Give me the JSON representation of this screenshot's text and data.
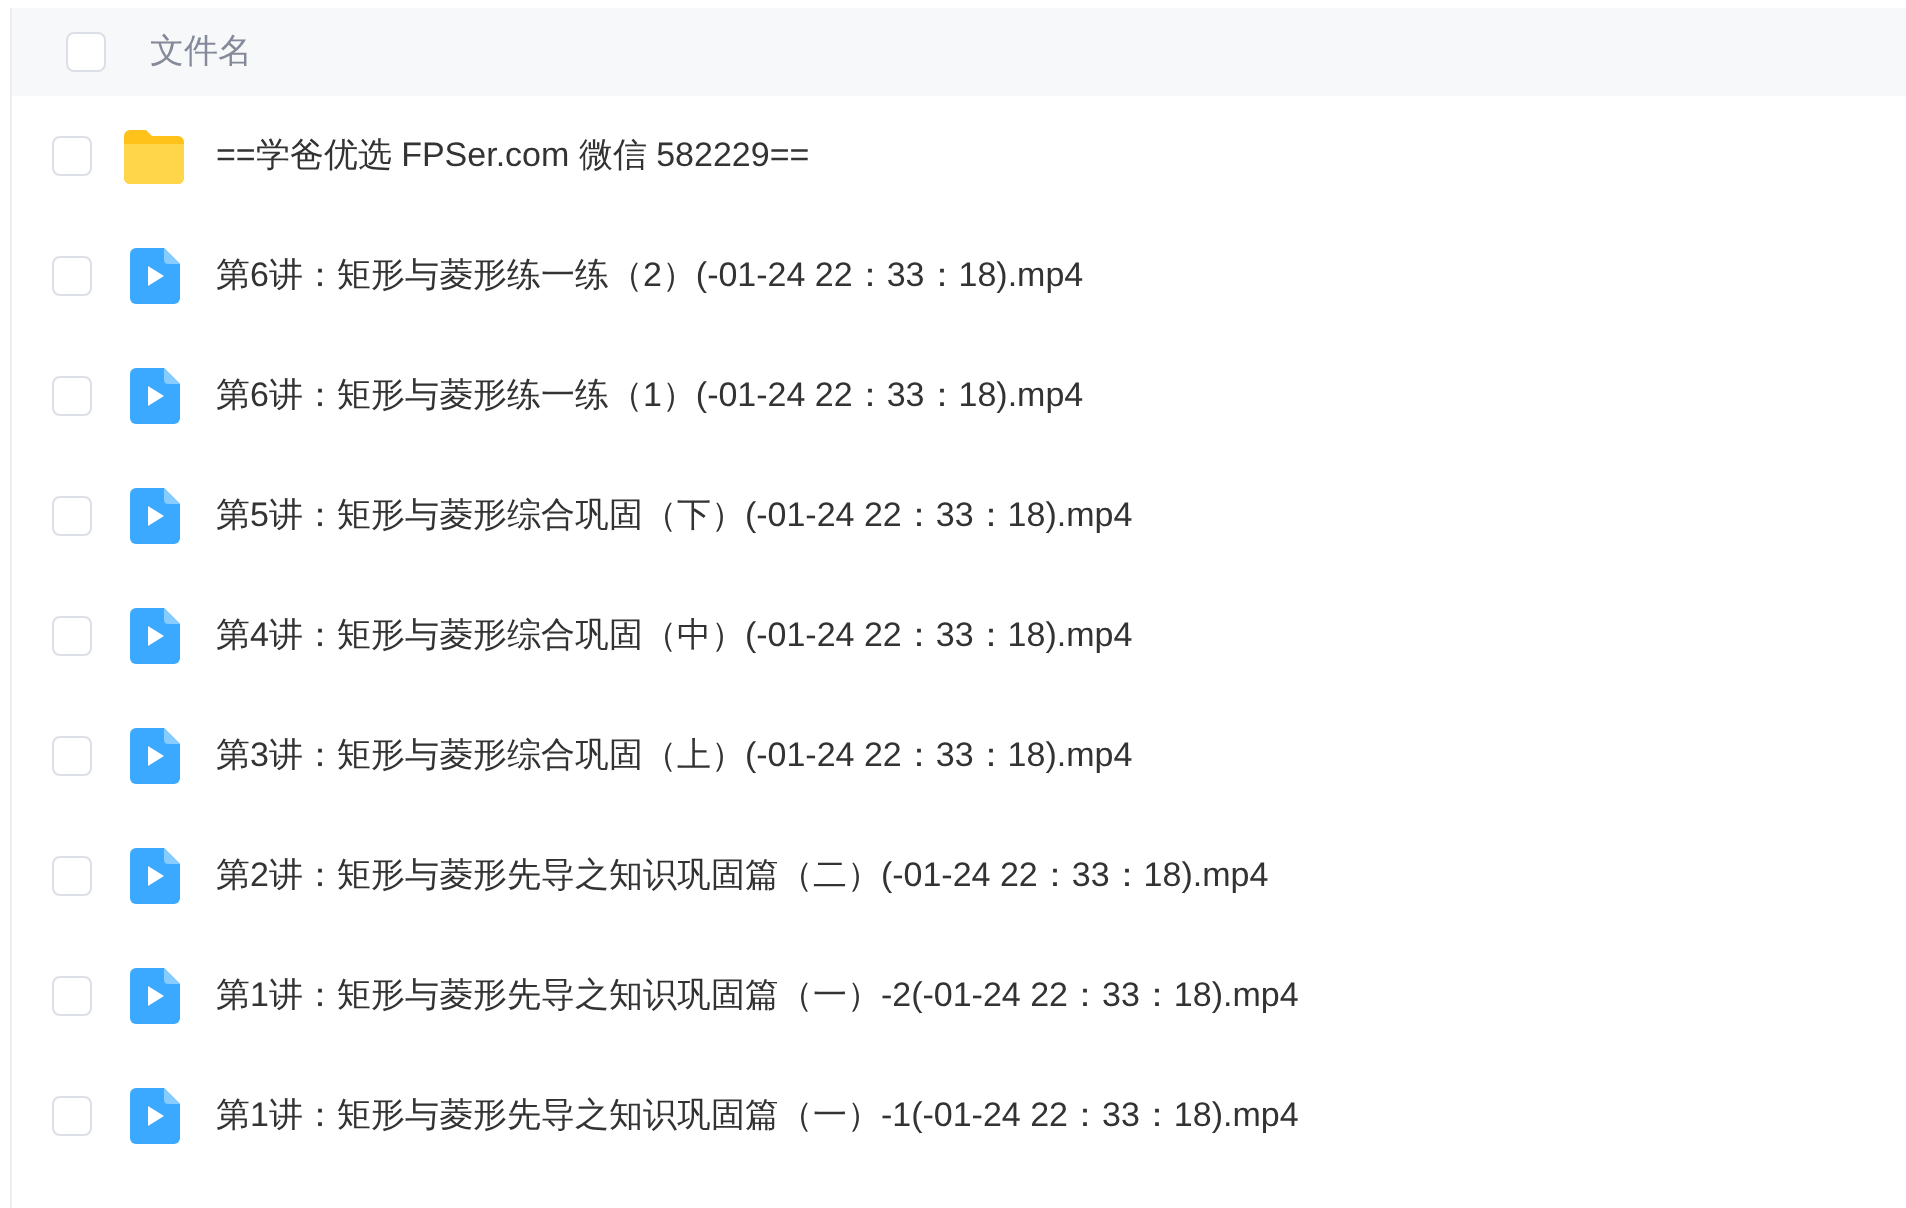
{
  "header": {
    "column_label": "文件名",
    "checked": false
  },
  "files": [
    {
      "kind": "folder",
      "name": "==学爸优选 FPSer.com 微信 582229==",
      "checked": false
    },
    {
      "kind": "video",
      "name": "第6讲：矩形与菱形练一练（2）(-01-24 22：33：18).mp4",
      "checked": false
    },
    {
      "kind": "video",
      "name": "第6讲：矩形与菱形练一练（1）(-01-24 22：33：18).mp4",
      "checked": false
    },
    {
      "kind": "video",
      "name": "第5讲：矩形与菱形综合巩固（下）(-01-24 22：33：18).mp4",
      "checked": false
    },
    {
      "kind": "video",
      "name": "第4讲：矩形与菱形综合巩固（中）(-01-24 22：33：18).mp4",
      "checked": false
    },
    {
      "kind": "video",
      "name": "第3讲：矩形与菱形综合巩固（上）(-01-24 22：33：18).mp4",
      "checked": false
    },
    {
      "kind": "video",
      "name": "第2讲：矩形与菱形先导之知识巩固篇（二）(-01-24 22：33：18).mp4",
      "checked": false
    },
    {
      "kind": "video",
      "name": "第1讲：矩形与菱形先导之知识巩固篇（一）-2(-01-24 22：33：18).mp4",
      "checked": false
    },
    {
      "kind": "video",
      "name": "第1讲：矩形与菱形先导之知识巩固篇（一）-1(-01-24 22：33：18).mp4",
      "checked": false
    }
  ]
}
